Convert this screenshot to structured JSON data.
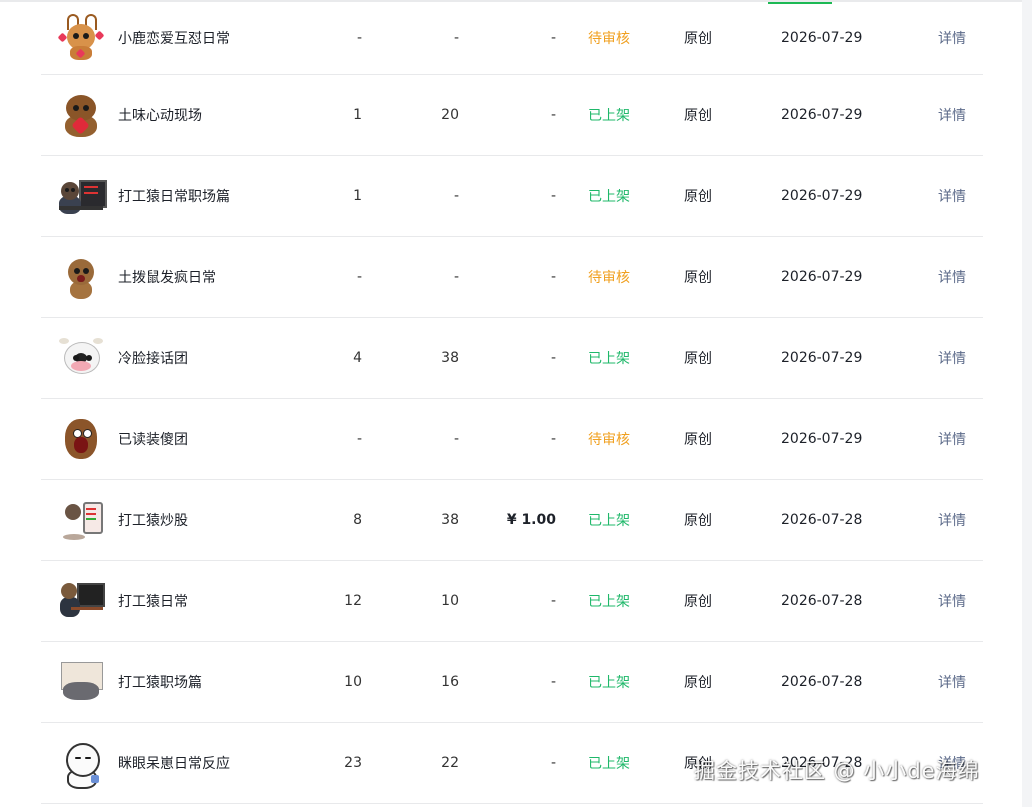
{
  "rows": [
    {
      "name": "小鹿恋爱互怼日常",
      "count1": "-",
      "count2": "-",
      "price": "-",
      "status": "待审核",
      "status_kind": "pending",
      "type": "原创",
      "date": "2026-07-29",
      "action": "详情",
      "thumb": "deer-sticker"
    },
    {
      "name": "土味心动现场",
      "count1": "1",
      "count2": "20",
      "price": "-",
      "status": "已上架",
      "status_kind": "live",
      "type": "原创",
      "date": "2026-07-29",
      "action": "详情",
      "thumb": "beaver-heart-sticker"
    },
    {
      "name": "打工猿日常职场篇",
      "count1": "1",
      "count2": "-",
      "price": "-",
      "status": "已上架",
      "status_kind": "live",
      "type": "原创",
      "date": "2026-07-29",
      "action": "详情",
      "thumb": "monkey-desk-sticker"
    },
    {
      "name": "土拨鼠发疯日常",
      "count1": "-",
      "count2": "-",
      "price": "-",
      "status": "待审核",
      "status_kind": "pending",
      "type": "原创",
      "date": "2026-07-29",
      "action": "详情",
      "thumb": "gopher-sticker"
    },
    {
      "name": "冷脸接话团",
      "count1": "4",
      "count2": "38",
      "price": "-",
      "status": "已上架",
      "status_kind": "live",
      "type": "原创",
      "date": "2026-07-29",
      "action": "详情",
      "thumb": "cow-sticker"
    },
    {
      "name": "已读装傻团",
      "count1": "-",
      "count2": "-",
      "price": "-",
      "status": "待审核",
      "status_kind": "pending",
      "type": "原创",
      "date": "2026-07-29",
      "action": "详情",
      "thumb": "shocked-beaver-sticker"
    },
    {
      "name": "打工猿炒股",
      "count1": "8",
      "count2": "38",
      "price": "¥ 1.00",
      "status": "已上架",
      "status_kind": "live",
      "type": "原创",
      "date": "2026-07-28",
      "action": "详情",
      "thumb": "stock-monkey-sticker"
    },
    {
      "name": "打工猿日常",
      "count1": "12",
      "count2": "10",
      "price": "-",
      "status": "已上架",
      "status_kind": "live",
      "type": "原创",
      "date": "2026-07-28",
      "action": "详情",
      "thumb": "office-monkey-sticker"
    },
    {
      "name": "打工猿职场篇",
      "count1": "10",
      "count2": "16",
      "price": "-",
      "status": "已上架",
      "status_kind": "live",
      "type": "原创",
      "date": "2026-07-28",
      "action": "详情",
      "thumb": "meeting-monkey-sticker"
    },
    {
      "name": "眯眼呆崽日常反应",
      "count1": "23",
      "count2": "22",
      "price": "-",
      "status": "已上架",
      "status_kind": "live",
      "type": "原创",
      "date": "2026-07-28",
      "action": "详情",
      "thumb": "blank-stare-sticker"
    }
  ],
  "watermark": "掘金技术社区 @ 小小de海绵",
  "colors": {
    "pending": "#f0a020",
    "live": "#1fb86a",
    "link": "#5d6b8a",
    "accent": "#1db954"
  }
}
